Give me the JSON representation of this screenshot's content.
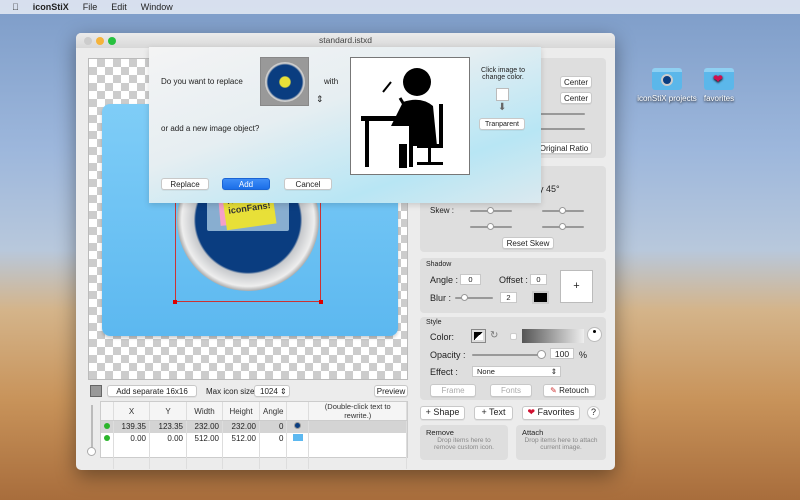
{
  "menubar": {
    "apple": "",
    "app": "iconStiX",
    "items": [
      "File",
      "Edit",
      "Window"
    ]
  },
  "desktop": [
    {
      "label": "iconStiX projects",
      "icon": "folder-icon"
    },
    {
      "label": "favorites",
      "icon": "folder-heart-icon"
    }
  ],
  "window": {
    "title": "standard.istxd"
  },
  "canvas": {
    "note_text": "Hello, iconFans!"
  },
  "dialog": {
    "question1": "Do you want to replace",
    "with": "with",
    "question2": "or add a new image object?",
    "replace": "Replace",
    "add": "Add",
    "cancel": "Cancel",
    "click_hint": "Click image to change color.",
    "transparent": "Tranparent"
  },
  "transform": {
    "center1": "Center",
    "center2": "Center",
    "original_ratio": "Original Ratio",
    "rotate_label": "y 45°",
    "skew_label": "Skew :",
    "reset_skew": "Reset Skew"
  },
  "shadow": {
    "title": "Shadow",
    "angle_label": "Angle :",
    "angle": "0",
    "offset_label": "Offset :",
    "offset": "0",
    "blur_label": "Blur :",
    "blur": "2",
    "blur_fraction": 0.1,
    "plus": "+"
  },
  "style": {
    "title": "Style",
    "color_label": "Color:",
    "opacity_label": "Opacity :",
    "opacity": "100",
    "percent": "%",
    "opacity_fraction": 1.0,
    "effect_label": "Effect :",
    "effect": "None",
    "frame": "Frame",
    "fonts": "Fonts",
    "retouch": "Retouch"
  },
  "actions": {
    "shape": "+ Shape",
    "text": "+ Text",
    "favorites": "Favorites",
    "help": "?"
  },
  "drop": {
    "remove_title": "Remove",
    "remove_hint": "Drop items here to remove custom icon.",
    "attach_title": "Attach",
    "attach_hint": "Drop items here to attach current image."
  },
  "bottombar": {
    "add_separate": "Add separate 16x16",
    "max_label": "Max icon size:",
    "max_value": "1024",
    "preview": "Preview"
  },
  "table": {
    "headers": [
      "",
      "X",
      "Y",
      "Width",
      "Height",
      "Angle",
      "",
      "(Double-click text to rewrite.)"
    ],
    "rows": [
      {
        "x": "139.35",
        "y": "123.35",
        "w": "232.00",
        "h": "232.00",
        "angle": "0",
        "icon": "circle-icon-thumb"
      },
      {
        "x": "0.00",
        "y": "0.00",
        "w": "512.00",
        "h": "512.00",
        "angle": "0",
        "icon": "folder-thumb"
      }
    ]
  },
  "colors": {
    "accent": "#1b6ee8",
    "folder": "#5cb8f0",
    "status_dot": "#2bb52b"
  }
}
